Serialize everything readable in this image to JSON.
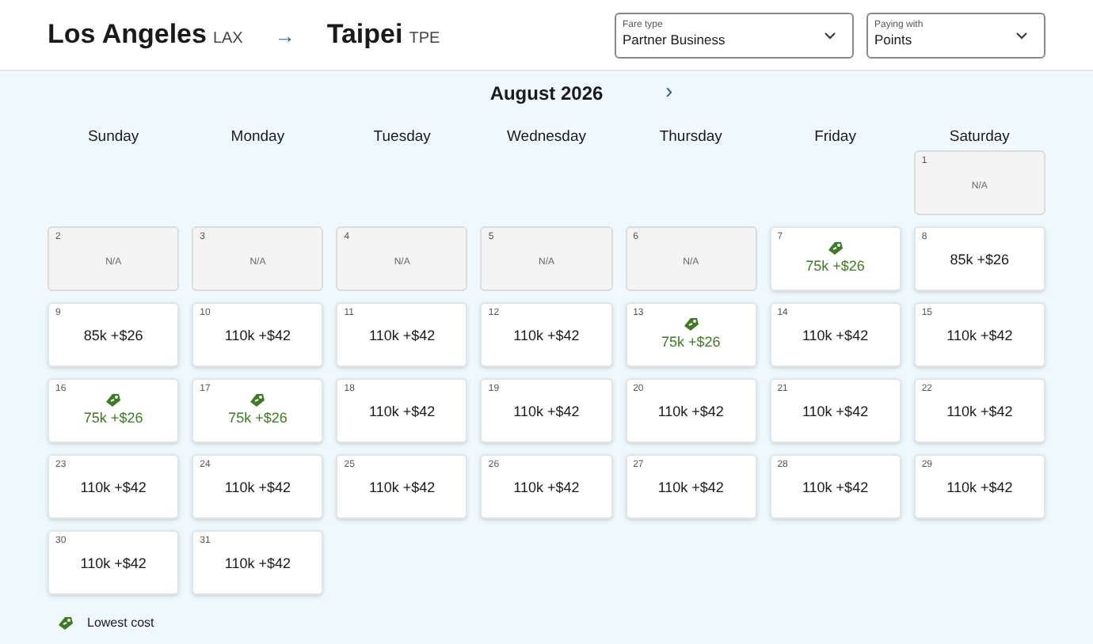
{
  "route": {
    "origin": "Los Angeles",
    "origin_code": "LAX",
    "arrow": "→",
    "destination": "Taipei",
    "destination_code": "TPE"
  },
  "selects": [
    {
      "label": "Fare type",
      "value": "Partner Business"
    },
    {
      "label": "Paying with",
      "value": "Points"
    }
  ],
  "calendar": {
    "month": "August 2026",
    "next": "›",
    "weekdays": [
      "Sunday",
      "Monday",
      "Tuesday",
      "Wednesday",
      "Thursday",
      "Friday",
      "Saturday"
    ],
    "weeks": [
      [
        {
          "kind": "blank"
        },
        {
          "kind": "blank"
        },
        {
          "kind": "blank"
        },
        {
          "kind": "blank"
        },
        {
          "kind": "blank"
        },
        {
          "kind": "blank"
        },
        {
          "kind": "na",
          "day": "1",
          "text": "N/A"
        }
      ],
      [
        {
          "kind": "na",
          "day": "2",
          "text": "N/A"
        },
        {
          "kind": "na",
          "day": "3",
          "text": "N/A"
        },
        {
          "kind": "na",
          "day": "4",
          "text": "N/A"
        },
        {
          "kind": "na",
          "day": "5",
          "text": "N/A"
        },
        {
          "kind": "na",
          "day": "6",
          "text": "N/A"
        },
        {
          "kind": "price",
          "day": "7",
          "text": "75k +$26",
          "lowest": true
        },
        {
          "kind": "price",
          "day": "8",
          "text": "85k +$26",
          "lowest": false
        }
      ],
      [
        {
          "kind": "price",
          "day": "9",
          "text": "85k +$26",
          "lowest": false
        },
        {
          "kind": "price",
          "day": "10",
          "text": "110k +$42",
          "lowest": false
        },
        {
          "kind": "price",
          "day": "11",
          "text": "110k +$42",
          "lowest": false
        },
        {
          "kind": "price",
          "day": "12",
          "text": "110k +$42",
          "lowest": false
        },
        {
          "kind": "price",
          "day": "13",
          "text": "75k +$26",
          "lowest": true
        },
        {
          "kind": "price",
          "day": "14",
          "text": "110k +$42",
          "lowest": false
        },
        {
          "kind": "price",
          "day": "15",
          "text": "110k +$42",
          "lowest": false
        }
      ],
      [
        {
          "kind": "price",
          "day": "16",
          "text": "75k +$26",
          "lowest": true
        },
        {
          "kind": "price",
          "day": "17",
          "text": "75k +$26",
          "lowest": true
        },
        {
          "kind": "price",
          "day": "18",
          "text": "110k +$42",
          "lowest": false
        },
        {
          "kind": "price",
          "day": "19",
          "text": "110k +$42",
          "lowest": false
        },
        {
          "kind": "price",
          "day": "20",
          "text": "110k +$42",
          "lowest": false
        },
        {
          "kind": "price",
          "day": "21",
          "text": "110k +$42",
          "lowest": false
        },
        {
          "kind": "price",
          "day": "22",
          "text": "110k +$42",
          "lowest": false
        }
      ],
      [
        {
          "kind": "price",
          "day": "23",
          "text": "110k +$42",
          "lowest": false
        },
        {
          "kind": "price",
          "day": "24",
          "text": "110k +$42",
          "lowest": false
        },
        {
          "kind": "price",
          "day": "25",
          "text": "110k +$42",
          "lowest": false
        },
        {
          "kind": "price",
          "day": "26",
          "text": "110k +$42",
          "lowest": false
        },
        {
          "kind": "price",
          "day": "27",
          "text": "110k +$42",
          "lowest": false
        },
        {
          "kind": "price",
          "day": "28",
          "text": "110k +$42",
          "lowest": false
        },
        {
          "kind": "price",
          "day": "29",
          "text": "110k +$42",
          "lowest": false
        }
      ],
      [
        {
          "kind": "price",
          "day": "30",
          "text": "110k +$42",
          "lowest": false
        },
        {
          "kind": "price",
          "day": "31",
          "text": "110k +$42",
          "lowest": false
        },
        {
          "kind": "blank"
        },
        {
          "kind": "blank"
        },
        {
          "kind": "blank"
        },
        {
          "kind": "blank"
        },
        {
          "kind": "blank"
        }
      ]
    ]
  },
  "legend": {
    "label": "Lowest cost"
  }
}
